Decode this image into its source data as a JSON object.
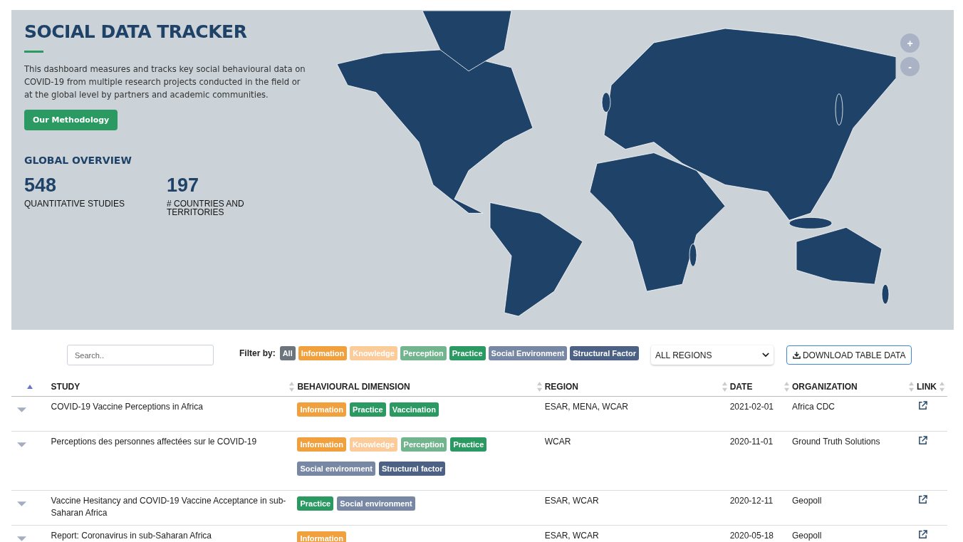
{
  "hero": {
    "title": "SOCIAL DATA TRACKER",
    "description": "This dashboard measures and tracks key social behavioural data on COVID-19 from multiple research projects conducted in the field or at the global level by partners and academic communities.",
    "methodology_button": "Our Methodology",
    "overview_title": "GLOBAL OVERVIEW",
    "stats": [
      {
        "value": "548",
        "label": "QUANTITATIVE STUDIES"
      },
      {
        "value": "197",
        "label": "# COUNTRIES AND TERRITORIES"
      }
    ],
    "zoom_buttons": [
      "+",
      "-"
    ]
  },
  "controls": {
    "search": {
      "placeholder": "Search.."
    },
    "filter_label": "Filter by:",
    "filters": [
      {
        "label": "All",
        "color": "#6c757d"
      },
      {
        "label": "Information",
        "color": "#f0a03c"
      },
      {
        "label": "Knowledge",
        "color": "#fbcb9a"
      },
      {
        "label": "Perception",
        "color": "#72b48d"
      },
      {
        "label": "Practice",
        "color": "#2a9a62"
      },
      {
        "label": "Social Environment",
        "color": "#7887a3"
      },
      {
        "label": "Structural Factor",
        "color": "#4c6183"
      }
    ],
    "region_select": "ALL REGIONS",
    "download_button": "DOWNLOAD TABLE DATA"
  },
  "table": {
    "columns": [
      {
        "sorted": true
      },
      {
        "label": "STUDY",
        "sorted": false
      },
      {
        "label": "BEHAVIOURAL DIMENSION",
        "sorted": false
      },
      {
        "label": "REGION",
        "sorted": false
      },
      {
        "label": "DATE",
        "sorted": false
      },
      {
        "label": "ORGANIZATION",
        "sorted": false
      },
      {
        "label": "LINK",
        "sorted": false
      }
    ],
    "rows": [
      {
        "study": "COVID-19 Vaccine Perceptions in Africa",
        "tags": [
          {
            "label": "Information",
            "color": "#f0a03c"
          },
          {
            "label": "Practice",
            "color": "#2a9a62"
          },
          {
            "label": "Vaccination",
            "color": "#2a9a62"
          }
        ],
        "region": "ESAR, MENA, WCAR",
        "date": "2021-02-01",
        "organization": "Africa CDC"
      },
      {
        "study": "Perceptions des personnes affectées sur le COVID-19",
        "tags": [
          {
            "label": "Information",
            "color": "#f0a03c"
          },
          {
            "label": "Knowledge",
            "color": "#fbcb9a"
          },
          {
            "label": "Perception",
            "color": "#72b48d"
          },
          {
            "label": "Practice",
            "color": "#2a9a62"
          },
          {
            "label": "Social environment",
            "color": "#7887a3"
          },
          {
            "label": "Structural factor",
            "color": "#4c6183"
          }
        ],
        "region": "WCAR",
        "date": "2020-11-01",
        "organization": "Ground Truth Solutions"
      },
      {
        "study": "Vaccine Hesitancy and COVID-19 Vaccine Acceptance in sub-Saharan Africa",
        "tags": [
          {
            "label": "Practice",
            "color": "#2a9a62"
          },
          {
            "label": "Social environment",
            "color": "#7887a3"
          }
        ],
        "region": "ESAR, WCAR",
        "date": "2020-12-11",
        "organization": "Geopoll"
      },
      {
        "study": "Report: Coronavirus in sub-Saharan Africa",
        "tags": [
          {
            "label": "Information",
            "color": "#f0a03c"
          }
        ],
        "region": "ESAR, WCAR",
        "date": "2020-05-18",
        "organization": "Geopoll"
      }
    ]
  }
}
